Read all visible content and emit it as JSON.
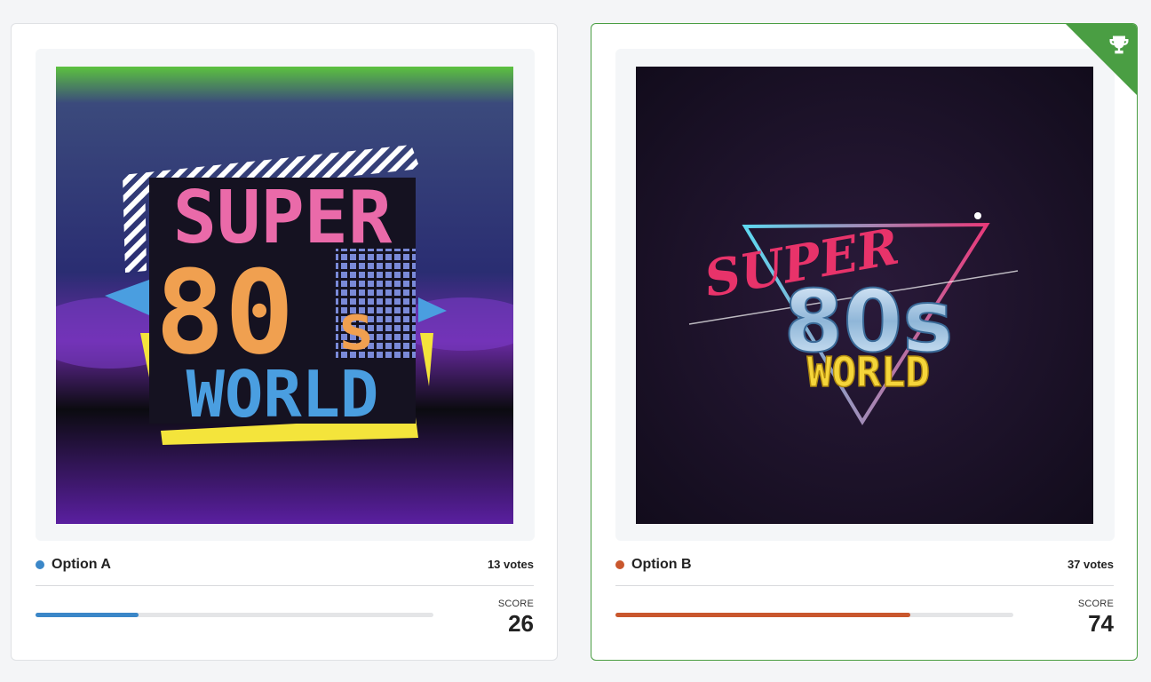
{
  "options": [
    {
      "label": "Option A",
      "votes": "13 votes",
      "score_label": "SCORE",
      "score": "26",
      "progress_fraction": 0.26,
      "color": "#3b87c8",
      "image_text": {
        "line1": "SUPER",
        "line2": "80",
        "line2b": "s",
        "line3": "WORLD"
      }
    },
    {
      "label": "Option B",
      "votes": "37 votes",
      "score_label": "SCORE",
      "score": "74",
      "progress_fraction": 0.74,
      "color": "#c9572d",
      "winner": true,
      "winner_icon": "trophy-icon",
      "winner_color": "#4a9e43",
      "image_text": {
        "line1": "SUPER",
        "line2": "80s",
        "line3": "WORLD"
      }
    }
  ]
}
